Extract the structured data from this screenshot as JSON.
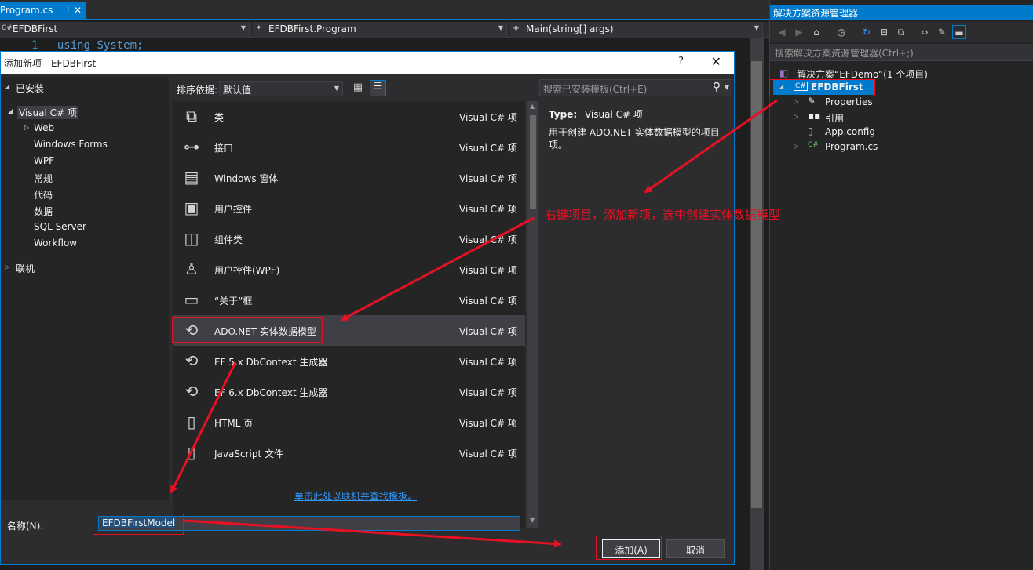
{
  "editor": {
    "tab_title": "Program.cs",
    "tab_pin": "⊣",
    "tab_close": "✕",
    "nav_project": "EFDBFirst",
    "nav_class": "EFDBFirst.Program",
    "nav_member": "Main(string[] args)",
    "code_line_number": "1",
    "code_text": "using System;"
  },
  "dialog": {
    "title": "添加新项 - EFDBFirst",
    "help": "?",
    "close": "✕",
    "tree": {
      "installed": "已安装",
      "visual_csharp": "Visual C# 项",
      "web": "Web",
      "windows_forms": "Windows Forms",
      "wpf": "WPF",
      "general": "常规",
      "code": "代码",
      "data": "数据",
      "sql_server": "SQL Server",
      "workflow": "Workflow",
      "online": "联机"
    },
    "toolbar": {
      "sort_label": "排序依据:",
      "sort_value": "默认值",
      "search_placeholder": "搜索已安装模板(Ctrl+E)"
    },
    "items": [
      {
        "name": "类",
        "type": "Visual C# 项",
        "icon": "class-icon"
      },
      {
        "name": "接口",
        "type": "Visual C# 项",
        "icon": "interface-icon"
      },
      {
        "name": "Windows 窗体",
        "type": "Visual C# 项",
        "icon": "windows-form-icon"
      },
      {
        "name": "用户控件",
        "type": "Visual C# 项",
        "icon": "user-control-icon"
      },
      {
        "name": "组件类",
        "type": "Visual C# 项",
        "icon": "component-class-icon"
      },
      {
        "name": "用户控件(WPF)",
        "type": "Visual C# 项",
        "icon": "wpf-user-control-icon"
      },
      {
        "name": "“关于”框",
        "type": "Visual C# 项",
        "icon": "about-box-icon"
      },
      {
        "name": "ADO.NET 实体数据模型",
        "type": "Visual C# 项",
        "icon": "entity-model-icon"
      },
      {
        "name": "EF 5.x DbContext 生成器",
        "type": "Visual C# 项",
        "icon": "ef5-generator-icon"
      },
      {
        "name": "EF 6.x DbContext 生成器",
        "type": "Visual C# 项",
        "icon": "ef6-generator-icon"
      },
      {
        "name": "HTML 页",
        "type": "Visual C# 项",
        "icon": "html-page-icon"
      },
      {
        "name": "JavaScript 文件",
        "type": "Visual C# 项",
        "icon": "javascript-file-icon"
      }
    ],
    "detail": {
      "type_label": "Type:",
      "type_value": "Visual C# 项",
      "description": "用于创建 ADO.NET 实体数据模型的项目项。"
    },
    "online_link": "单击此处以联机并查找模板。",
    "name_label": "名称(N):",
    "name_value": "EFDBFirstModel",
    "add_button": "添加(A)",
    "cancel_button": "取消"
  },
  "solution_explorer": {
    "title": "解决方案资源管理器",
    "search_placeholder": "搜索解决方案资源管理器(Ctrl+;)",
    "solution": "解决方案“EFDemo”(1 个项目)",
    "project": "EFDBFirst",
    "children": [
      "Properties",
      "引用",
      "App.config",
      "Program.cs"
    ]
  },
  "annotation": {
    "text": "右键项目，添加新项，选中创建实体数据模型"
  },
  "colors": {
    "accent": "#007acc",
    "annotation_red": "#e81123",
    "background": "#1e1e1e"
  }
}
